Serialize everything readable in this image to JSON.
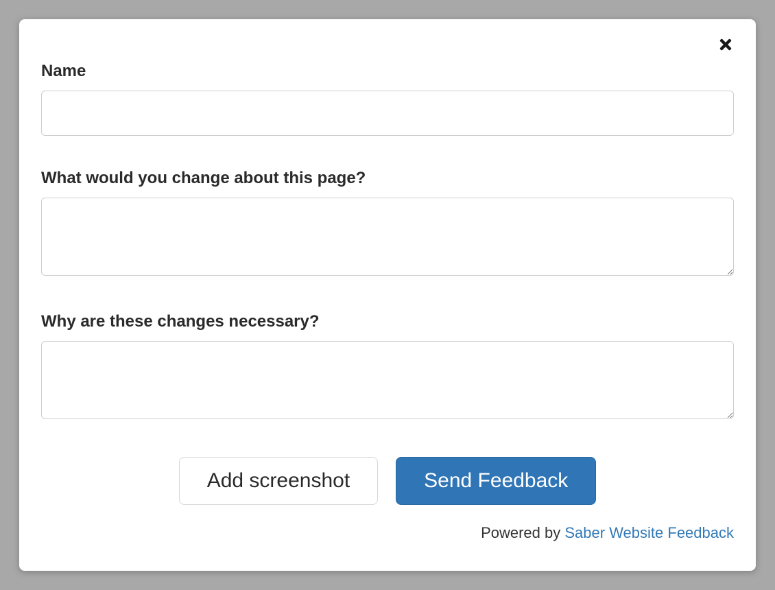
{
  "form": {
    "name_label": "Name",
    "name_value": "",
    "change_label": "What would you change about this page?",
    "change_value": "",
    "why_label": "Why are these changes necessary?",
    "why_value": ""
  },
  "buttons": {
    "screenshot_label": "Add screenshot",
    "send_label": "Send Feedback"
  },
  "footer": {
    "powered_by_prefix": "Powered by ",
    "powered_by_link": "Saber Website Feedback"
  },
  "colors": {
    "primary": "#3075b5",
    "border": "#cfcfcf",
    "text": "#2a2a2a",
    "link": "#337ab7",
    "backdrop": "#a8a8a8"
  }
}
